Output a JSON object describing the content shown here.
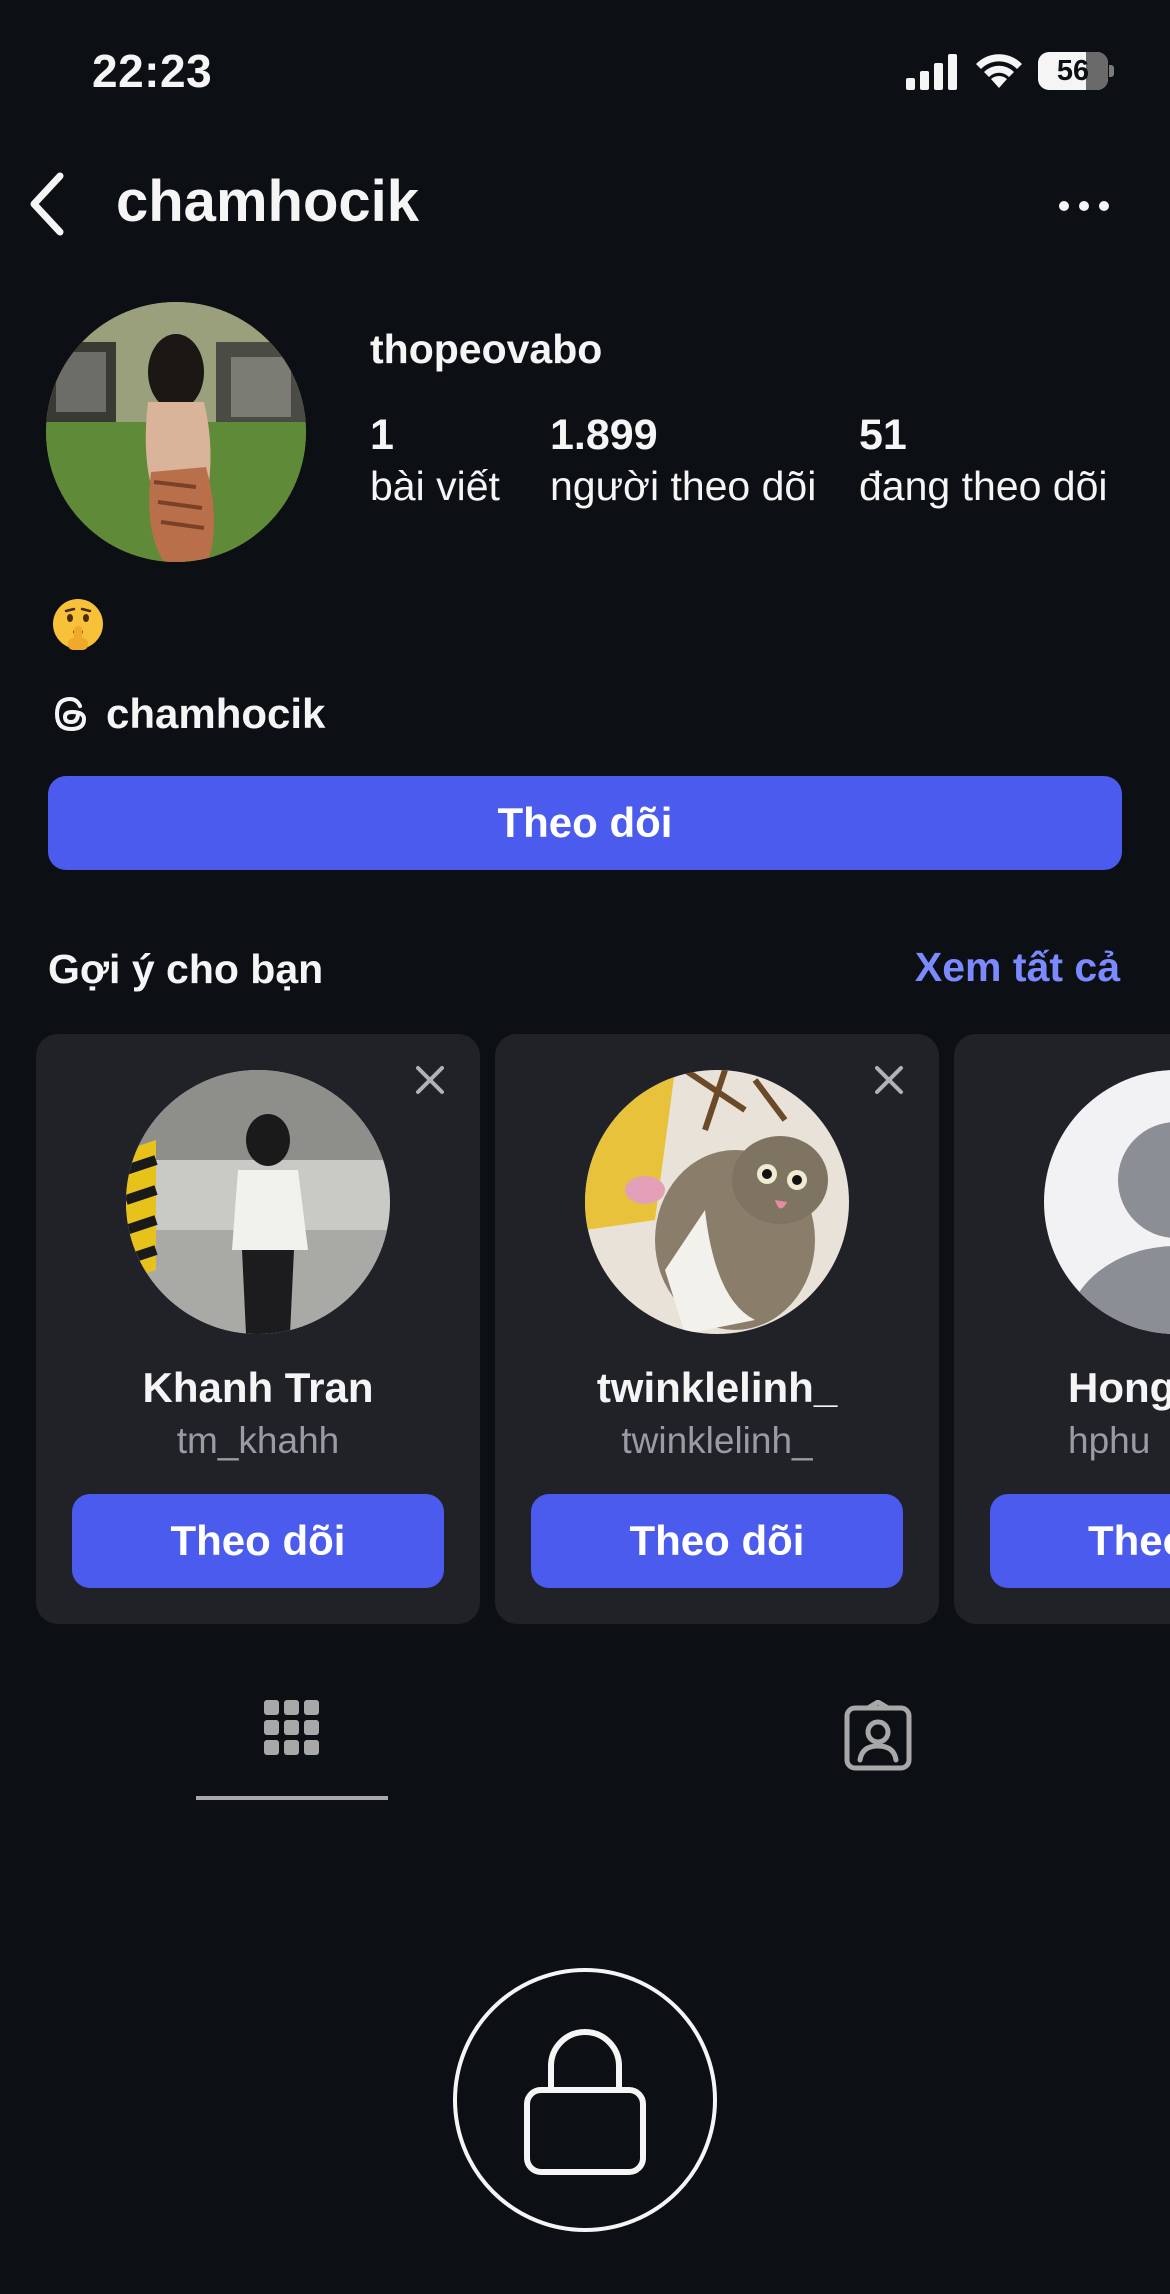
{
  "status_bar": {
    "time": "22:23",
    "battery": "56",
    "icons": [
      "signal-icon",
      "wifi-icon",
      "battery-icon"
    ]
  },
  "header": {
    "title": "chamhocik",
    "back_icon": "chevron-left-icon",
    "more_icon": "more-horizontal-icon"
  },
  "profile": {
    "name": "thopeovabo",
    "stats": {
      "posts": {
        "value": "1",
        "label": "bài viết"
      },
      "followers": {
        "value": "1.899",
        "label": "người theo dõi"
      },
      "following": {
        "value": "51",
        "label": "đang theo dõi"
      }
    },
    "bio_emoji": "🤫",
    "threads_handle": "chamhocik",
    "follow_label": "Theo dõi"
  },
  "suggestions": {
    "title": "Gợi ý cho bạn",
    "see_all": "Xem tất cả",
    "cards": [
      {
        "name": "Khanh Tran",
        "handle": "tm_khahh",
        "follow_label": "Theo dõi"
      },
      {
        "name": "twinklelinh_",
        "handle": "twinklelinh_",
        "follow_label": "Theo dõi"
      },
      {
        "name": "Hong",
        "handle": "hphu",
        "follow_label": "Theo"
      }
    ]
  },
  "tabs": [
    "grid-icon",
    "tagged-icon"
  ],
  "colors": {
    "background": "#0c1014",
    "accent": "#4a5bee",
    "link": "#7b8bff",
    "card": "#202228"
  }
}
